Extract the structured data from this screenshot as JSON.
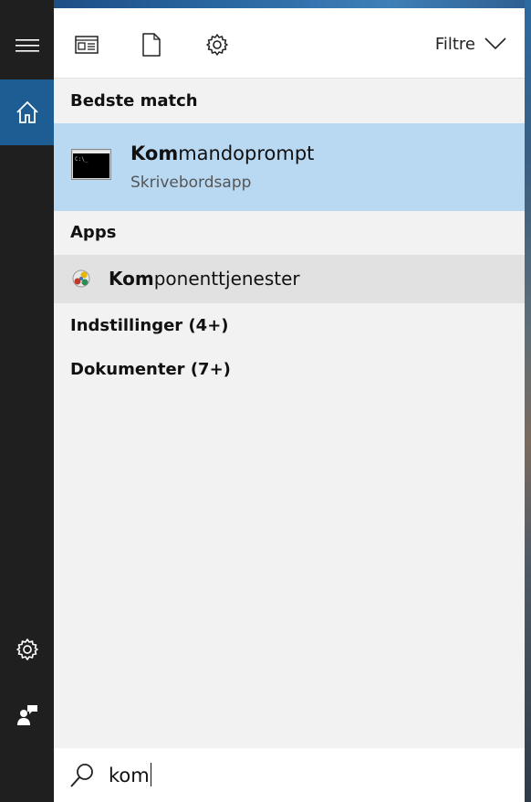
{
  "toolbar": {
    "filter_label": "Filtre"
  },
  "sections": {
    "best_match": "Bedste match",
    "apps": "Apps",
    "settings": "Indstillinger (4+)",
    "documents": "Dokumenter (7+)"
  },
  "best_match": {
    "title_match": "Kom",
    "title_rest": "mandoprompt",
    "subtitle": "Skrivebordsapp"
  },
  "apps": [
    {
      "match": "Kom",
      "rest": "ponenttjenester"
    }
  ],
  "search": {
    "query": "kom"
  },
  "icons": {
    "rail": [
      "hamburger-icon",
      "home-icon",
      "settings-icon",
      "feedback-icon"
    ],
    "toolbar": [
      "apps-icon",
      "documents-icon",
      "settings-icon",
      "chevron-down-icon"
    ],
    "search": "search-icon"
  },
  "colors": {
    "rail_bg": "#1f1f1f",
    "rail_active": "#1d5d94",
    "best_match_bg": "#b9d8f2",
    "app_row_bg": "#e1e1e1",
    "panel_bg": "#f2f2f2"
  }
}
